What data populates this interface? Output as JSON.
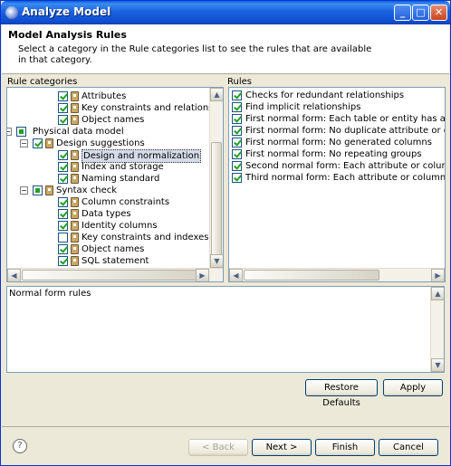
{
  "window": {
    "title": "Analyze Model"
  },
  "header": {
    "title": "Model Analysis Rules",
    "description": "Select a category in the Rule categories list to see the rules that are available in that category."
  },
  "categories_label": "Rule categories",
  "rules_label": "Rules",
  "tree": [
    {
      "label": "Attributes",
      "level": 3,
      "checked": "checked",
      "icon": true
    },
    {
      "label": "Key constraints and relationships",
      "level": 3,
      "checked": "checked",
      "icon": true
    },
    {
      "label": "Object names",
      "level": 3,
      "checked": "checked",
      "icon": true
    },
    {
      "label": "Physical data model",
      "level": 1,
      "checked": "partial",
      "expander": "−",
      "icon": false
    },
    {
      "label": "Design suggestions",
      "level": 2,
      "checked": "checked",
      "expander": "−",
      "icon": true
    },
    {
      "label": "Design and normalization",
      "level": 3,
      "checked": "checked",
      "icon": true,
      "selected": true
    },
    {
      "label": "Index and storage",
      "level": 3,
      "checked": "checked",
      "icon": true
    },
    {
      "label": "Naming standard",
      "level": 3,
      "checked": "checked",
      "icon": true
    },
    {
      "label": "Syntax check",
      "level": 2,
      "checked": "partial",
      "expander": "−",
      "icon": true
    },
    {
      "label": "Column constraints",
      "level": 3,
      "checked": "checked",
      "icon": true
    },
    {
      "label": "Data types",
      "level": 3,
      "checked": "checked",
      "icon": true
    },
    {
      "label": "Identity columns",
      "level": 3,
      "checked": "checked",
      "icon": true
    },
    {
      "label": "Key constraints and indexes",
      "level": 3,
      "checked": "unchecked",
      "icon": true
    },
    {
      "label": "Object names",
      "level": 3,
      "checked": "checked",
      "icon": true
    },
    {
      "label": "SQL statement",
      "level": 3,
      "checked": "checked",
      "icon": true
    }
  ],
  "rules": [
    {
      "label": "Checks for redundant relationships",
      "checked": true
    },
    {
      "label": "Find implicit relationships",
      "checked": true
    },
    {
      "label": "First normal form: Each table or entity has a primary key",
      "checked": true
    },
    {
      "label": "First normal form: No duplicate attribute or column names",
      "checked": true
    },
    {
      "label": "First normal form: No generated columns",
      "checked": true
    },
    {
      "label": "First normal form: No repeating groups",
      "checked": true
    },
    {
      "label": "Second normal form: Each attribute or column depends on the entire key",
      "checked": true
    },
    {
      "label": "Third normal form: Each attribute or column depends only on the key",
      "checked": true
    }
  ],
  "description_text": "Normal form rules",
  "buttons": {
    "restore_defaults": "Restore Defaults",
    "apply": "Apply",
    "back": "< Back",
    "next": "Next >",
    "finish": "Finish",
    "cancel": "Cancel",
    "help": "?"
  }
}
